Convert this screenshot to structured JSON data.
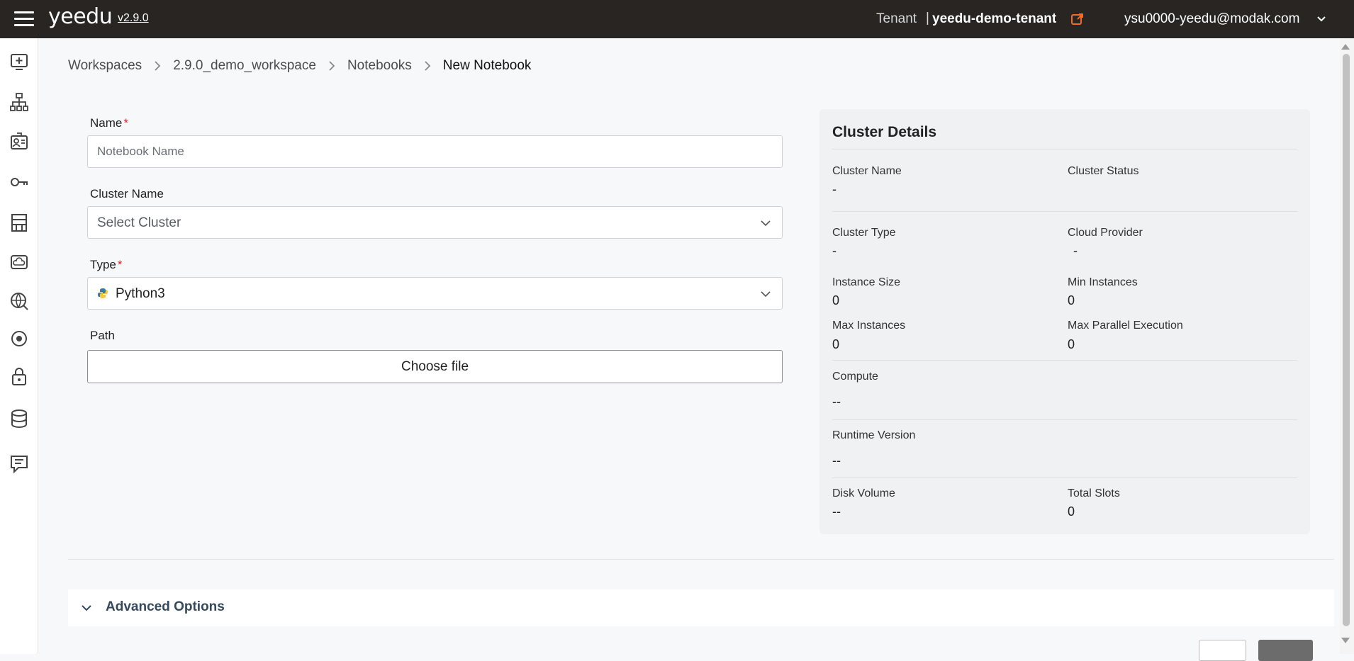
{
  "header": {
    "logo": "yeedu",
    "version": "v2.9.0",
    "tenant_label": "Tenant",
    "tenant_sep": "|",
    "tenant_name": "yeedu-demo-tenant",
    "user": "ysu0000-yeedu@modak.com"
  },
  "sidebar": {
    "items": [
      {
        "icon": "add-workspace-icon"
      },
      {
        "icon": "hierarchy-icon"
      },
      {
        "icon": "id-card-icon"
      },
      {
        "icon": "key-icon"
      },
      {
        "icon": "building-icon"
      },
      {
        "icon": "cloud-storage-icon"
      },
      {
        "icon": "globe-icon"
      },
      {
        "icon": "target-icon"
      },
      {
        "icon": "lock-icon"
      },
      {
        "icon": "database-icon"
      },
      {
        "icon": "notes-icon"
      }
    ]
  },
  "breadcrumb": [
    "Workspaces",
    "2.9.0_demo_workspace",
    "Notebooks",
    "New Notebook"
  ],
  "form": {
    "name_label": "Name",
    "name_placeholder": "Notebook Name",
    "cluster_label": "Cluster Name",
    "cluster_value": "Select Cluster",
    "type_label": "Type",
    "type_value": "Python3",
    "path_label": "Path",
    "choose_file": "Choose file",
    "required_mark": "*"
  },
  "cluster_details": {
    "title": "Cluster Details",
    "cluster_name_key": "Cluster Name",
    "cluster_name_val": "-",
    "cluster_status_key": "Cluster Status",
    "cluster_status_val": "",
    "cluster_type_key": "Cluster Type",
    "cluster_type_val": "-",
    "cloud_provider_key": "Cloud Provider",
    "cloud_provider_val": "-",
    "instance_size_key": "Instance Size",
    "instance_size_val": "0",
    "min_instances_key": "Min Instances",
    "min_instances_val": "0",
    "max_instances_key": "Max Instances",
    "max_instances_val": "0",
    "max_parallel_key": "Max Parallel Execution",
    "max_parallel_val": "0",
    "compute_key": "Compute",
    "compute_val": "--",
    "runtime_key": "Runtime Version",
    "runtime_val": "--",
    "disk_key": "Disk Volume",
    "disk_val": "--",
    "slots_key": "Total Slots",
    "slots_val": "0"
  },
  "advanced": {
    "label": "Advanced Options"
  },
  "colors": {
    "topbar": "#282522",
    "required": "#e0242c",
    "external_link": "#f26b21"
  }
}
